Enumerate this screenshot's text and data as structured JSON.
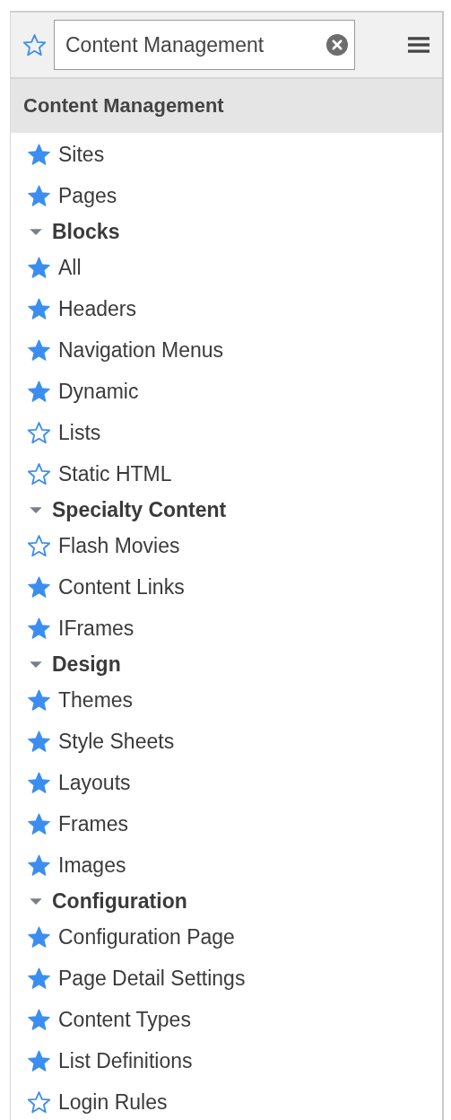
{
  "search": {
    "value": "Content Management",
    "favorite": false
  },
  "heading": "Content Management",
  "items": [
    {
      "label": "Sites",
      "favorite": true
    },
    {
      "label": "Pages",
      "favorite": true
    }
  ],
  "groups": [
    {
      "label": "Blocks",
      "expanded": true,
      "children": [
        {
          "label": "All",
          "favorite": true
        },
        {
          "label": "Headers",
          "favorite": true
        },
        {
          "label": "Navigation Menus",
          "favorite": true
        },
        {
          "label": "Dynamic",
          "favorite": true
        },
        {
          "label": "Lists",
          "favorite": false
        },
        {
          "label": "Static HTML",
          "favorite": false
        }
      ]
    },
    {
      "label": "Specialty Content",
      "expanded": true,
      "children": [
        {
          "label": "Flash Movies",
          "favorite": false
        },
        {
          "label": "Content Links",
          "favorite": true
        },
        {
          "label": "IFrames",
          "favorite": true
        }
      ]
    },
    {
      "label": "Design",
      "expanded": true,
      "children": [
        {
          "label": "Themes",
          "favorite": true
        },
        {
          "label": "Style Sheets",
          "favorite": true
        },
        {
          "label": "Layouts",
          "favorite": true
        },
        {
          "label": "Frames",
          "favorite": true
        },
        {
          "label": "Images",
          "favorite": true
        }
      ]
    },
    {
      "label": "Configuration",
      "expanded": true,
      "children": [
        {
          "label": "Configuration Page",
          "favorite": true
        },
        {
          "label": "Page Detail Settings",
          "favorite": true
        },
        {
          "label": "Content Types",
          "favorite": true
        },
        {
          "label": "List Definitions",
          "favorite": true
        },
        {
          "label": "Login Rules",
          "favorite": false
        }
      ]
    }
  ]
}
